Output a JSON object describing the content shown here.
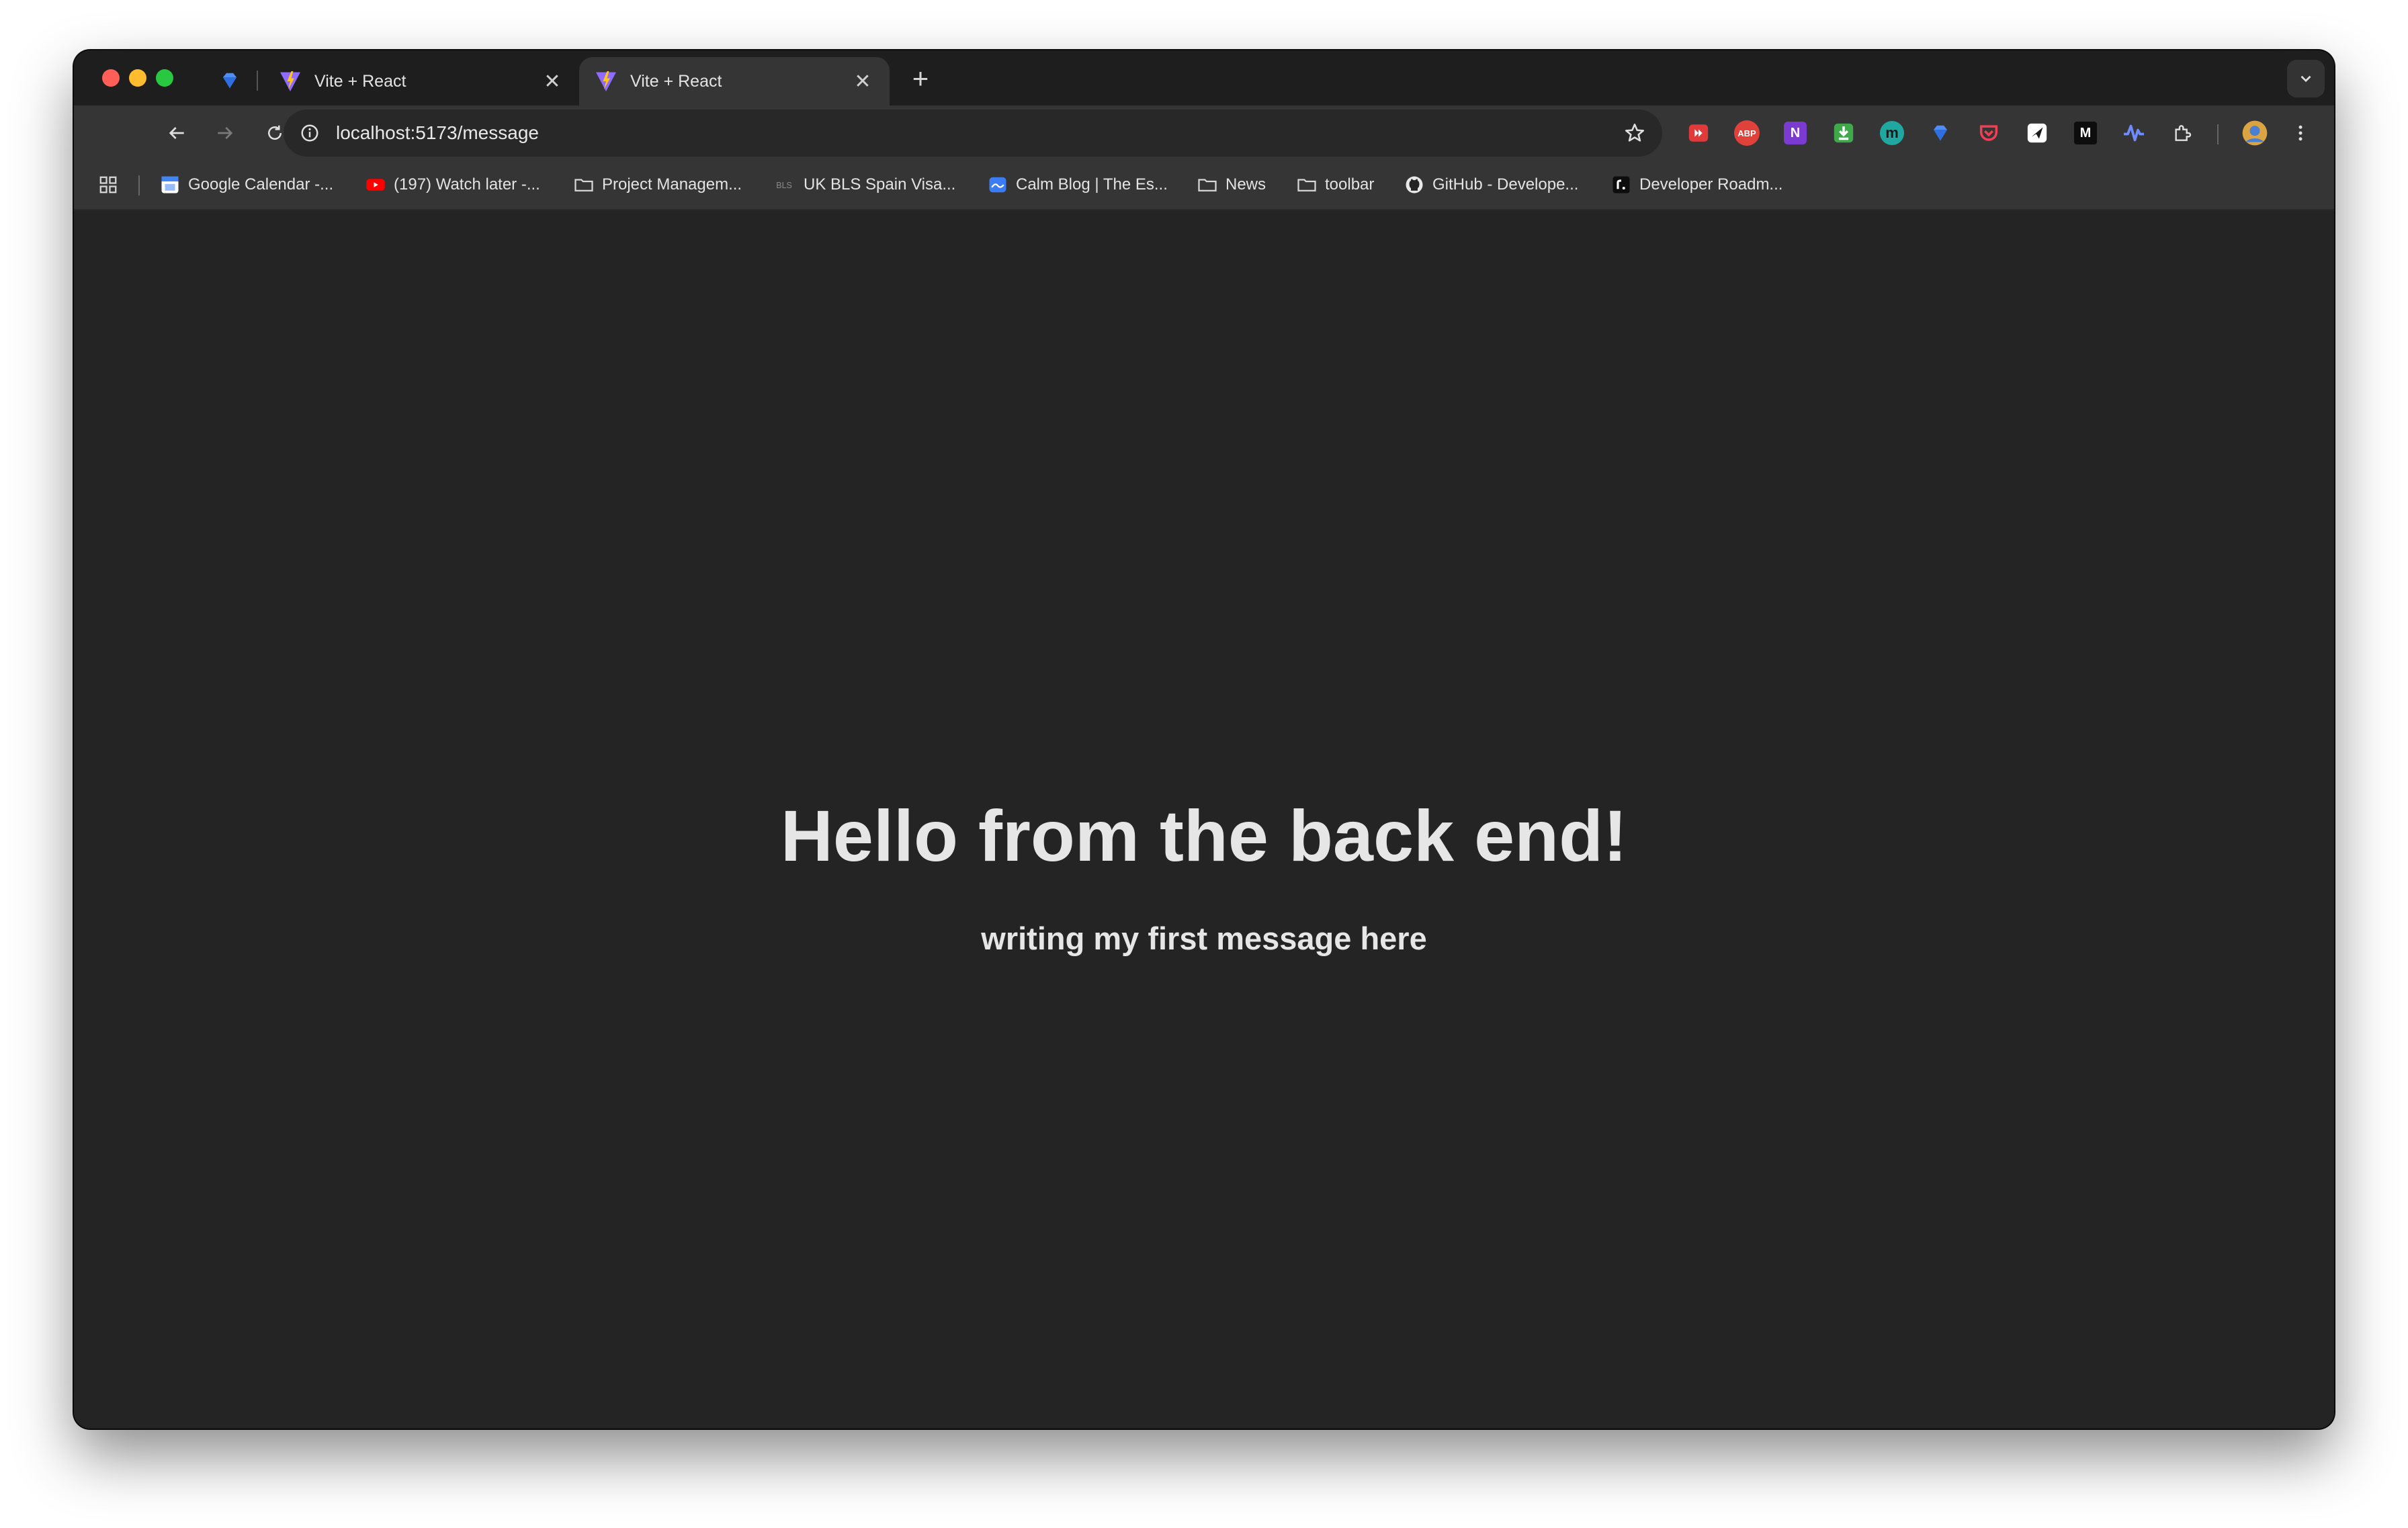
{
  "browser": {
    "tabs": [
      {
        "title": "Vite + React",
        "active": false
      },
      {
        "title": "Vite + React",
        "active": true
      }
    ],
    "new_tab_label": "+",
    "close_glyph": "✕",
    "address": "localhost:5173/message"
  },
  "bookmarks": [
    {
      "label": "Google Calendar -...",
      "icon": "google-calendar-icon"
    },
    {
      "label": "(197) Watch later -...",
      "icon": "youtube-icon"
    },
    {
      "label": "Project Managem...",
      "icon": "folder-icon"
    },
    {
      "label": "UK BLS Spain Visa...",
      "icon": "bls-icon"
    },
    {
      "label": "Calm Blog | The Es...",
      "icon": "calm-icon"
    },
    {
      "label": "News",
      "icon": "folder-icon"
    },
    {
      "label": "toolbar",
      "icon": "folder-icon"
    },
    {
      "label": "GitHub - Develope...",
      "icon": "github-icon"
    },
    {
      "label": "Developer Roadm...",
      "icon": "roadmap-icon"
    }
  ],
  "extensions": {
    "abp_text": "ABP",
    "onenote_text": "N",
    "m_text": "m",
    "medium_text": "M"
  },
  "page": {
    "heading": "Hello from the back end!",
    "message": "writing my first message here"
  },
  "colors": {
    "page_background": "#242424",
    "text": "#e6e6e6",
    "toolbar": "#353535",
    "tabstrip": "#1e1e1e"
  }
}
